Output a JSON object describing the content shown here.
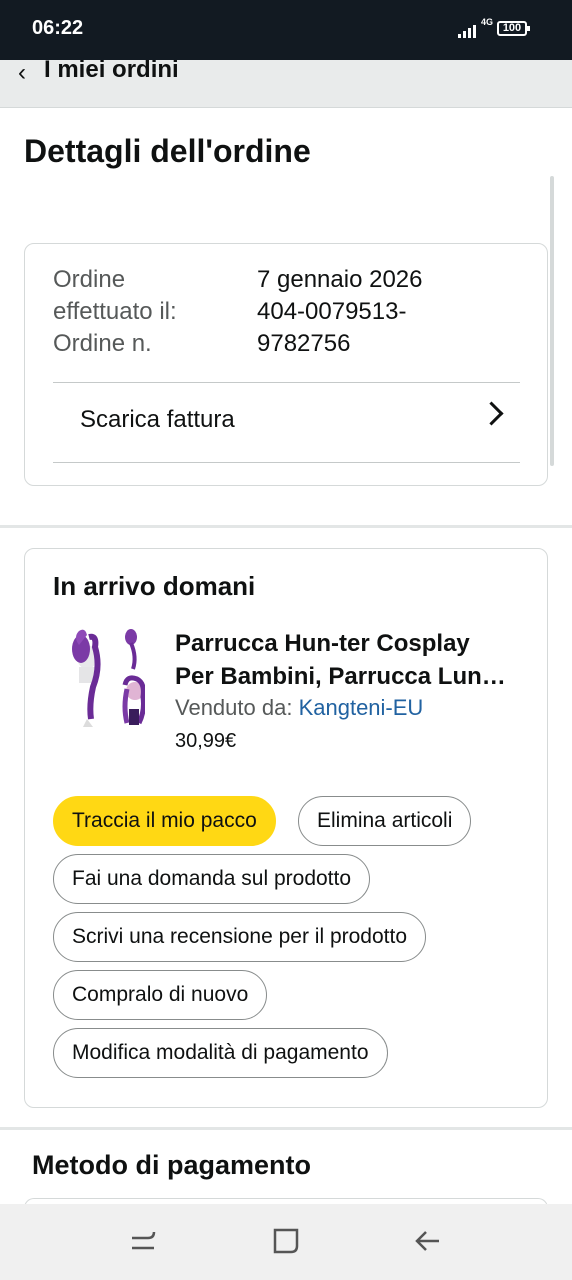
{
  "status_bar": {
    "time": "06:22",
    "network": "4G",
    "battery": "100"
  },
  "back_nav": {
    "label": "I miei ordini"
  },
  "page_title": "Dettagli dell'ordine",
  "order_info": {
    "labels": [
      "Ordine",
      "effettuato il:",
      "Ordine n."
    ],
    "values": [
      "7 gennaio 2026",
      "404-0079513-",
      "9782756"
    ],
    "invoice_label": "Scarica fattura"
  },
  "shipment": {
    "status": "In arrivo domani",
    "product": {
      "title_line1": "Parrucca Hun-ter Cosplay",
      "title_line2": "Per Bambini, Parrucca Lun…",
      "seller_prefix": "Venduto da:",
      "seller_name": "Kangteni-EU",
      "price": "30,99€"
    },
    "actions": [
      "Traccia il mio pacco",
      "Elimina articoli",
      "Fai una domanda sul prodotto",
      "Scrivi una recensione per il prodotto",
      "Compralo di nuovo",
      "Modifica modalità di pagamento"
    ]
  },
  "payment": {
    "title": "Metodo di pagamento"
  },
  "colors": {
    "primary_button": "#ffd814",
    "link": "#2162a1",
    "status_bar": "#121a22"
  }
}
